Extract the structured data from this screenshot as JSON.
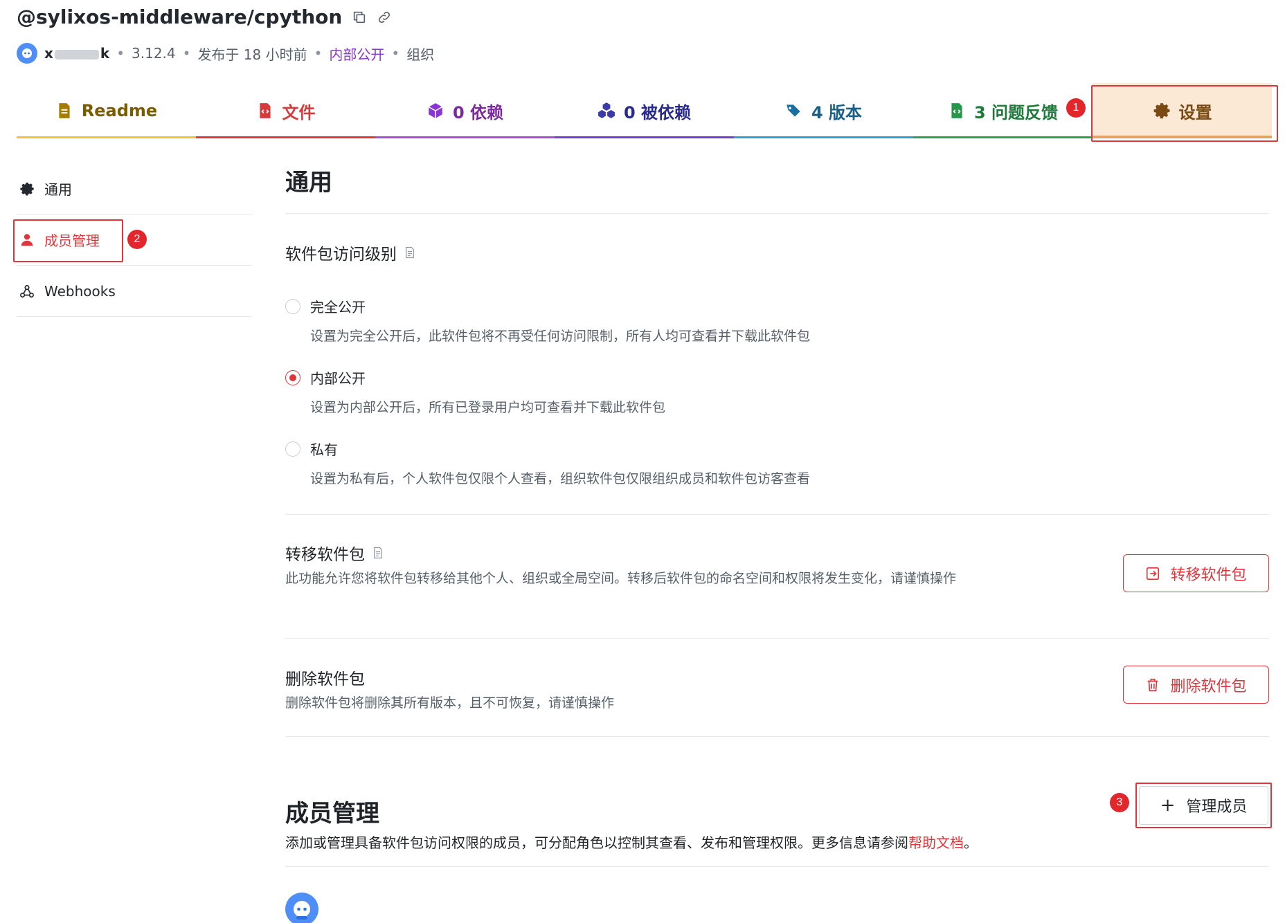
{
  "package": {
    "name": "@sylixos-middleware/cpython",
    "user_visible": "x",
    "user_tail": "k",
    "version": "3.12.4",
    "published": "发布于 18 小时前",
    "visibility": "内部公开",
    "owner_type": "组织"
  },
  "tabs": [
    {
      "label": "Readme",
      "icon": "readme-file-icon",
      "color": "#f2c13a",
      "text_color": "#7a5c00"
    },
    {
      "label": "文件",
      "icon": "code-file-icon",
      "color": "#e0363b",
      "text_color": "#d63a3a"
    },
    {
      "label": "0 依赖",
      "icon": "cube-icon",
      "color": "#b04ad6",
      "text_color": "#7b2a9e"
    },
    {
      "label": "0 被依赖",
      "icon": "cubes-icon",
      "color": "#6f3fd1",
      "text_color": "#2a2a8c"
    },
    {
      "label": "4 版本",
      "icon": "tags-icon",
      "color": "#2fa0d6",
      "text_color": "#1a5f86"
    },
    {
      "label": "3 问题反馈",
      "icon": "issue-file-icon",
      "color": "#2e9e4f",
      "text_color": "#1e7a3a"
    },
    {
      "label": "设置",
      "icon": "gear-icon",
      "color": "#e0a468",
      "text_color": "#7a4a12"
    }
  ],
  "steps": [
    "1",
    "2",
    "3"
  ],
  "sidebar": {
    "items": [
      {
        "label": "通用",
        "icon": "gear-icon"
      },
      {
        "label": "成员管理",
        "icon": "user-icon"
      },
      {
        "label": "Webhooks",
        "icon": "webhook-icon"
      }
    ]
  },
  "general": {
    "title": "通用",
    "access_title": "软件包访问级别",
    "options": [
      {
        "label": "完全公开",
        "desc": "设置为完全公开后，此软件包将不再受任何访问限制，所有人均可查看并下载此软件包",
        "selected": false
      },
      {
        "label": "内部公开",
        "desc": "设置为内部公开后，所有已登录用户均可查看并下载此软件包",
        "selected": true
      },
      {
        "label": "私有",
        "desc": "设置为私有后，个人软件包仅限个人查看，组织软件包仅限组织成员和软件包访客查看",
        "selected": false
      }
    ],
    "transfer_title": "转移软件包",
    "transfer_desc": "此功能允许您将软件包转移给其他个人、组织或全局空间。转移后软件包的命名空间和权限将发生变化，请谨慎操作",
    "transfer_button": "转移软件包",
    "delete_title": "删除软件包",
    "delete_desc": "删除软件包将删除其所有版本，且不可恢复，请谨慎操作",
    "delete_button": "删除软件包"
  },
  "members": {
    "title": "成员管理",
    "desc": "添加或管理具备软件包访问权限的成员，可分配角色以控制其查看、发布和管理权限。更多信息请参阅",
    "help_link": "帮助文档",
    "desc_end": "。",
    "manage_button": "管理成员"
  },
  "colors": {
    "accent": "#e0363b",
    "active_tab_bg": "#fbe9d6"
  }
}
